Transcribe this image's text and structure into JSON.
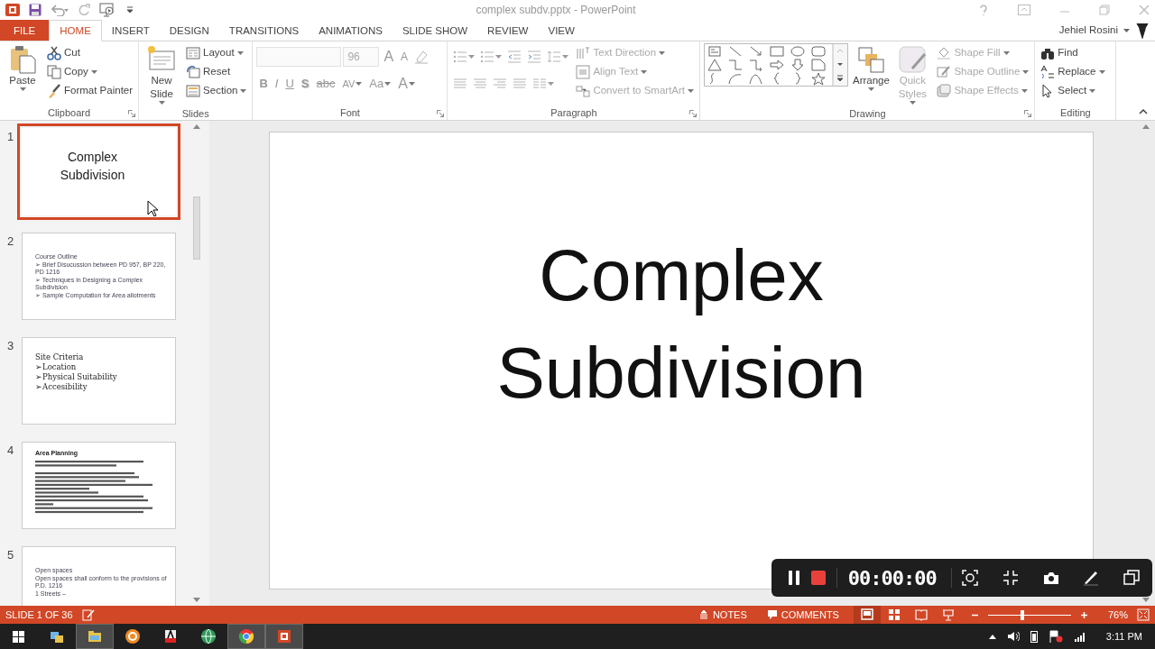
{
  "window": {
    "title": "complex subdv.pptx - PowerPoint",
    "user": "Jehiel Rosini"
  },
  "tabs": [
    {
      "label": "FILE",
      "kind": "file",
      "selected": false
    },
    {
      "label": "HOME",
      "kind": "tab",
      "selected": true
    },
    {
      "label": "INSERT",
      "kind": "tab",
      "selected": false
    },
    {
      "label": "DESIGN",
      "kind": "tab",
      "selected": false
    },
    {
      "label": "TRANSITIONS",
      "kind": "tab",
      "selected": false
    },
    {
      "label": "ANIMATIONS",
      "kind": "tab",
      "selected": false
    },
    {
      "label": "SLIDE SHOW",
      "kind": "tab",
      "selected": false
    },
    {
      "label": "REVIEW",
      "kind": "tab",
      "selected": false
    },
    {
      "label": "VIEW",
      "kind": "tab",
      "selected": false
    }
  ],
  "ribbon": [
    {
      "title": "Clipboard",
      "launcher": true,
      "columns": [
        [
          {
            "kind": "large",
            "label": "Paste",
            "dropdown": true,
            "disabled": false
          }
        ],
        [
          {
            "kind": "small",
            "label": "Cut",
            "dropdown": false,
            "disabled": false
          },
          {
            "kind": "small",
            "label": "Copy",
            "dropdown": true,
            "disabled": false
          },
          {
            "kind": "small",
            "label": "Format Painter",
            "dropdown": false,
            "disabled": false
          }
        ]
      ]
    },
    {
      "title": "Slides",
      "launcher": false,
      "columns": [
        [
          {
            "kind": "large",
            "label": "New Slide",
            "dropdown": true,
            "disabled": false
          }
        ],
        [
          {
            "kind": "small",
            "label": "Layout",
            "dropdown": true,
            "disabled": false
          },
          {
            "kind": "small",
            "label": "Reset",
            "dropdown": false,
            "disabled": false
          },
          {
            "kind": "small",
            "label": "Section",
            "dropdown": true,
            "disabled": false
          }
        ]
      ]
    },
    {
      "title": "Font",
      "launcher": true,
      "columns": [
        [
          {
            "kind": "row",
            "items": [
              {
                "kind": "field",
                "disabled": true
              },
              {
                "kind": "field",
                "value": "96",
                "disabled": true
              },
              {
                "kind": "glyph",
                "label": "A",
                "dropdown": false,
                "disabled": true
              },
              {
                "kind": "glyph",
                "label": "A",
                "dropdown": false,
                "disabled": true
              },
              {
                "kind": "icon",
                "dropdown": false,
                "disabled": true
              }
            ]
          },
          {
            "kind": "row",
            "items": [
              {
                "kind": "glyph",
                "label": "B",
                "dropdown": false,
                "disabled": true
              },
              {
                "kind": "glyph",
                "label": "I",
                "dropdown": false,
                "disabled": true
              },
              {
                "kind": "glyph",
                "label": "U",
                "dropdown": false,
                "disabled": true
              },
              {
                "kind": "glyph",
                "label": "S",
                "dropdown": false,
                "disabled": true
              },
              {
                "kind": "glyph",
                "label": "abc",
                "dropdown": false,
                "disabled": true
              },
              {
                "kind": "glyph",
                "label": "AV",
                "dropdown": true,
                "disabled": true
              },
              {
                "kind": "glyph",
                "label": "Aa",
                "dropdown": true,
                "disabled": true
              },
              {
                "kind": "glyph",
                "label": "A",
                "dropdown": true,
                "disabled": true
              }
            ]
          }
        ]
      ]
    },
    {
      "title": "Paragraph",
      "launcher": true,
      "columns": [
        [
          {
            "kind": "row",
            "items": [
              {
                "kind": "icon",
                "dropdown": true,
                "disabled": true
              },
              {
                "kind": "icon",
                "dropdown": true,
                "disabled": true
              },
              {
                "kind": "icon",
                "dropdown": false,
                "disabled": true
              },
              {
                "kind": "icon",
                "dropdown": false,
                "disabled": true
              },
              {
                "kind": "icon",
                "dropdown": true,
                "disabled": true
              }
            ]
          },
          {
            "kind": "row",
            "items": [
              {
                "kind": "icon",
                "dropdown": false,
                "disabled": true
              },
              {
                "kind": "icon",
                "dropdown": false,
                "disabled": true
              },
              {
                "kind": "icon",
                "dropdown": false,
                "disabled": true
              },
              {
                "kind": "icon",
                "dropdown": false,
                "disabled": true
              },
              {
                "kind": "icon",
                "dropdown": true,
                "disabled": true
              }
            ]
          }
        ],
        [
          {
            "kind": "small",
            "label": "Text Direction",
            "dropdown": true,
            "disabled": true
          },
          {
            "kind": "small",
            "label": "Align Text",
            "dropdown": true,
            "disabled": true
          },
          {
            "kind": "small",
            "label": "Convert to SmartArt",
            "dropdown": true,
            "disabled": true
          }
        ]
      ]
    },
    {
      "title": "Drawing",
      "launcher": true,
      "columns": [
        [
          {
            "kind": "gallery",
            "disabled": false
          }
        ],
        [
          {
            "kind": "large",
            "label": "Arrange",
            "dropdown": true,
            "disabled": false
          }
        ],
        [
          {
            "kind": "large",
            "label": "Quick Styles",
            "dropdown": true,
            "disabled": true
          }
        ],
        [
          {
            "kind": "small",
            "label": "Shape Fill",
            "dropdown": true,
            "disabled": true
          },
          {
            "kind": "small",
            "label": "Shape Outline",
            "dropdown": true,
            "disabled": true
          },
          {
            "kind": "small",
            "label": "Shape Effects",
            "dropdown": true,
            "disabled": true
          }
        ]
      ]
    },
    {
      "title": "Editing",
      "launcher": false,
      "columns": [
        [
          {
            "kind": "small",
            "label": "Find",
            "dropdown": false,
            "disabled": false
          },
          {
            "kind": "small",
            "label": "Replace",
            "dropdown": true,
            "disabled": false
          },
          {
            "kind": "small",
            "label": "Select",
            "dropdown": true,
            "disabled": false
          }
        ]
      ]
    }
  ],
  "slides": [
    {
      "number": "1",
      "kind": "title",
      "selected": true,
      "title": "Complex Subdivision"
    },
    {
      "number": "2",
      "kind": "bullets",
      "selected": false,
      "title": "Course Outline",
      "bullets": [
        "➢ Brief Disucussion between PD 957, BP 220, PD 1216",
        "➢ Techniques in Designing a Complex Subdivision",
        "➢ Sample Computation for Area allotments"
      ]
    },
    {
      "number": "3",
      "kind": "criteria",
      "selected": false,
      "title": "Site Criteria",
      "bullets": [
        "➢Location",
        "➢Physical Suitability",
        "➢Accesibility"
      ]
    },
    {
      "number": "4",
      "kind": "dense",
      "selected": false,
      "title": "Area Planning"
    },
    {
      "number": "5",
      "kind": "bullets",
      "selected": false,
      "title": "Open spaces",
      "bullets": [
        "Open spaces shall conform to the provisions of P.D. 1216",
        "1 Streets –"
      ]
    }
  ],
  "editor": {
    "title": "Complex Subdivision"
  },
  "recorder": {
    "time": "00:00:00"
  },
  "status_bar": {
    "slide_info": "SLIDE 1 OF 36",
    "notes": "NOTES",
    "comments": "COMMENTS",
    "views": [
      {
        "selected": true
      },
      {
        "selected": false
      },
      {
        "selected": false
      },
      {
        "selected": false
      }
    ],
    "zoom": {
      "level": 0.41,
      "reading": "76%"
    }
  },
  "taskbar": {
    "apps": [
      {
        "running": false
      },
      {
        "running": true
      },
      {
        "running": false
      },
      {
        "running": false
      },
      {
        "running": false
      },
      {
        "running": true
      },
      {
        "running": true
      }
    ],
    "clock": "3:11 PM"
  }
}
